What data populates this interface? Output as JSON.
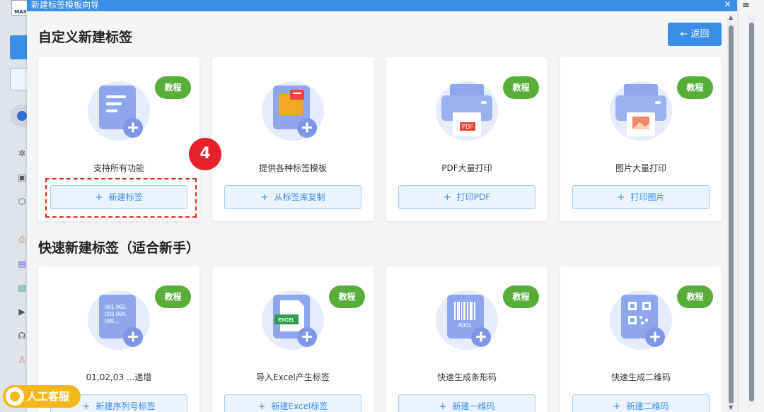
{
  "bg_app": {
    "logo_text": "MAS",
    "left_icons": [
      "settings-icon",
      "template-icon",
      "box-icon",
      "printer-icon",
      "document-icon",
      "image-icon",
      "video-icon",
      "headset-icon",
      "user-icon"
    ],
    "menu_icon": "≡"
  },
  "dialog": {
    "title": "新建标签模板向导",
    "close": "×",
    "back_button": "← 返回",
    "section1_title": "自定义新建标签",
    "section2_title": "快速新建标签（适合新手）",
    "step_marker": "4",
    "badge_text": "教程",
    "cards_row1": [
      {
        "label": "支持所有功能",
        "button": "新建标签",
        "badge": true,
        "icon": "doc"
      },
      {
        "label": "提供各种标签模板",
        "button": "从标签库复制",
        "badge": false,
        "icon": "folder"
      },
      {
        "label": "PDF大量打印",
        "button": "打印PDF",
        "badge": true,
        "icon": "printer-pdf"
      },
      {
        "label": "图片大量打印",
        "button": "打印图片",
        "badge": true,
        "icon": "printer-img"
      }
    ],
    "cards_row2": [
      {
        "label": "01,02,03 ...递增",
        "button": "新建序列号标签",
        "badge": true,
        "icon": "serial",
        "serial_text": [
          "001,002,",
          "003,004,",
          "005..."
        ]
      },
      {
        "label": "导入Excel产生标签",
        "button": "新建Excel标签",
        "badge": true,
        "icon": "excel",
        "excel_text": "EXCEL"
      },
      {
        "label": "快速生成条形码",
        "button": "新建一维码",
        "badge": true,
        "icon": "barcode",
        "barcode_text": "A001"
      },
      {
        "label": "快速生成二维码",
        "button": "新建二维码",
        "badge": true,
        "icon": "qrcode"
      }
    ],
    "pdf_tag": "PDF"
  },
  "service_button": "人工客服",
  "colors": {
    "accent": "#3a8ee6",
    "badge": "#59ae3a",
    "marker": "#e8222a",
    "service": "#f5b81c"
  }
}
